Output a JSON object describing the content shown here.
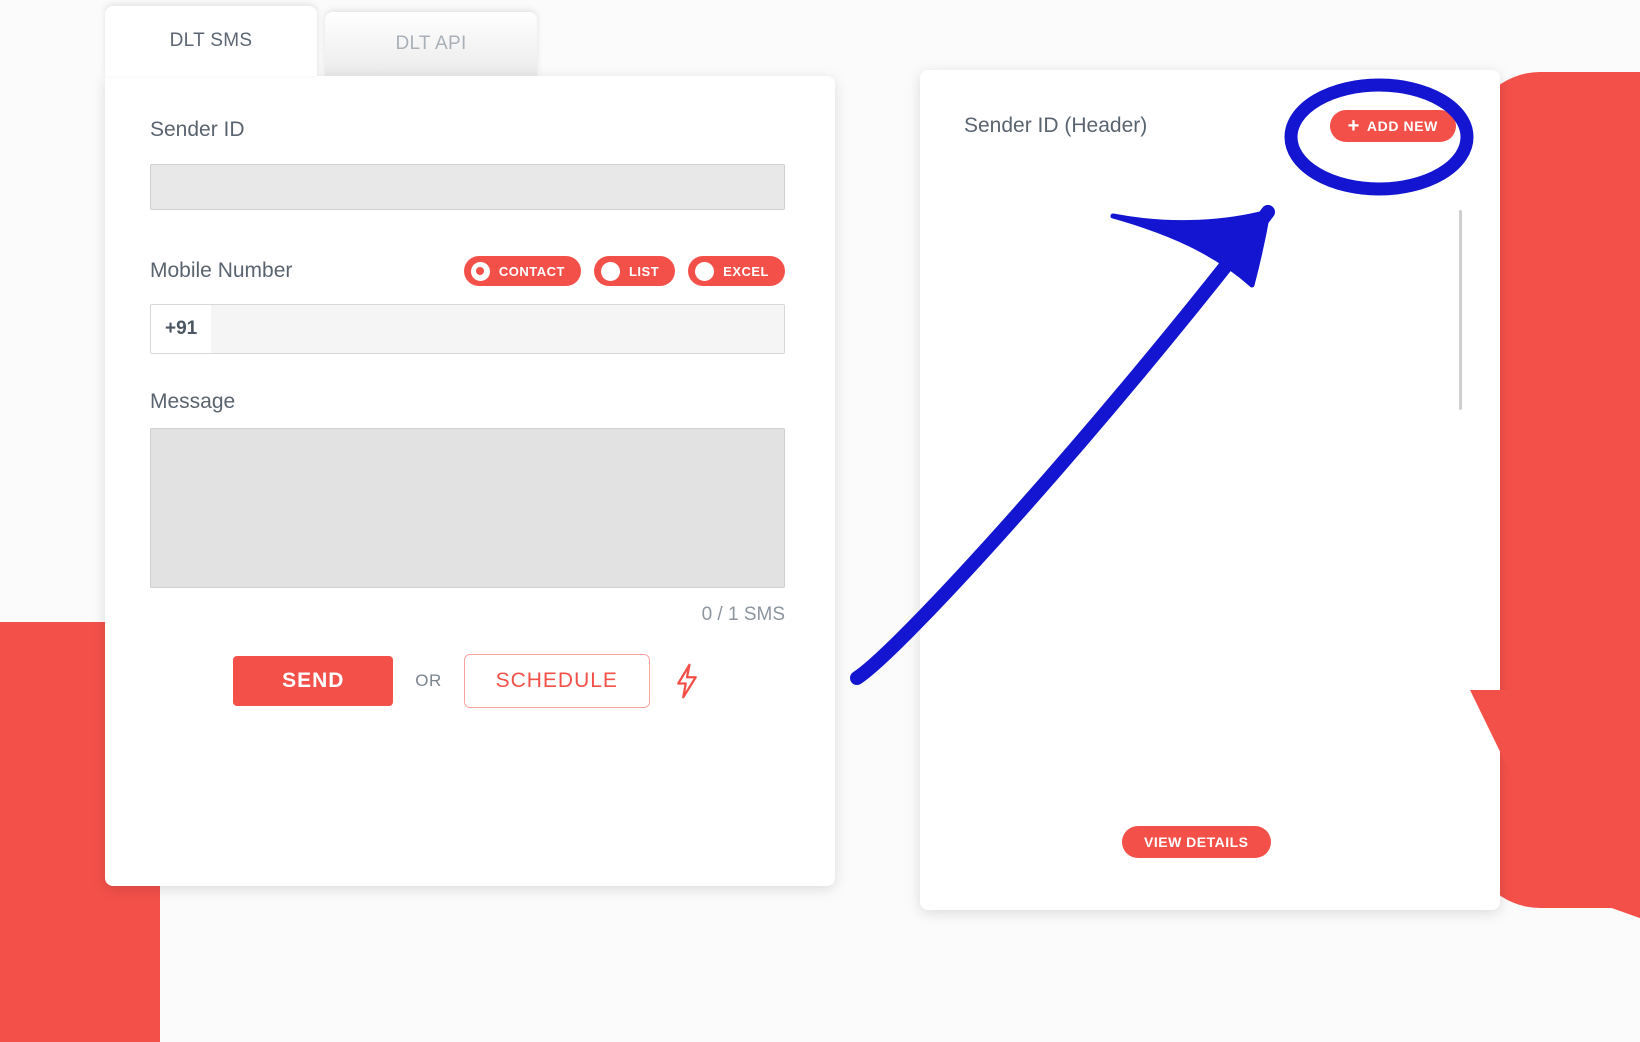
{
  "theme": {
    "accent": "#f4504a",
    "annotation": "#1415d0",
    "text_muted": "#5a646f",
    "disabled_field": "#e8e8e8"
  },
  "left_panel": {
    "tabs": [
      {
        "label": "DLT SMS",
        "active": true
      },
      {
        "label": "DLT API",
        "active": false
      }
    ],
    "sender_id": {
      "label": "Sender ID",
      "value": "",
      "placeholder": ""
    },
    "mobile_number": {
      "label": "Mobile Number",
      "country_prefix": "+91",
      "value": "",
      "placeholder": "",
      "source_options": [
        {
          "label": "CONTACT",
          "selected": true
        },
        {
          "label": "LIST",
          "selected": false
        },
        {
          "label": "EXCEL",
          "selected": false
        }
      ]
    },
    "message": {
      "label": "Message",
      "value": "",
      "placeholder": "",
      "counter": "0 / 1 SMS"
    },
    "actions": {
      "send_label": "SEND",
      "or_label": "OR",
      "schedule_label": "SCHEDULE",
      "quick_icon": "lightning-bolt-icon"
    }
  },
  "right_panel": {
    "title": "Sender ID (Header)",
    "add_new_label": "ADD NEW",
    "add_new_icon": "plus-icon",
    "view_details_label": "VIEW DETAILS",
    "list_items": []
  },
  "annotations": {
    "circle_target": "add-new-button",
    "arrow_direction": "up-right",
    "color": "#1415d0"
  }
}
